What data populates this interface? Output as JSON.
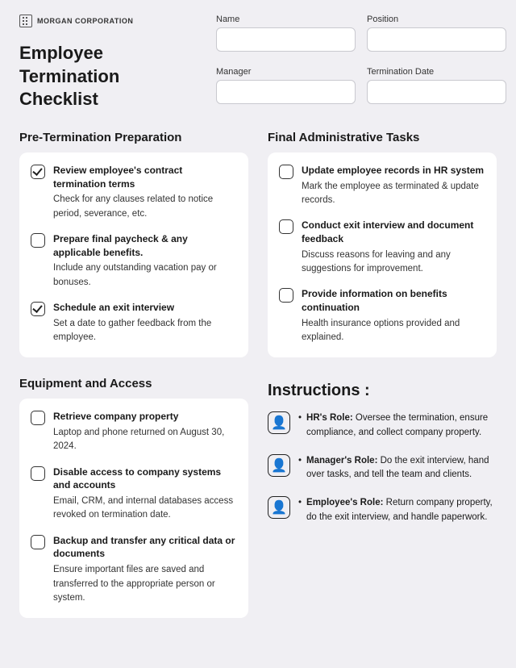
{
  "brand": "MORGAN CORPORATION",
  "title_line1": "Employee",
  "title_line2": "Termination Checklist",
  "fields": {
    "name": {
      "label": "Name",
      "value": ""
    },
    "position": {
      "label": "Position",
      "value": ""
    },
    "manager": {
      "label": "Manager",
      "value": ""
    },
    "termination_date": {
      "label": "Termination Date",
      "value": ""
    }
  },
  "sections": {
    "pre": {
      "heading": "Pre-Termination Preparation",
      "items": [
        {
          "checked": true,
          "title": "Review employee's contract termination terms",
          "desc": "Check for any clauses related to notice period, severance, etc."
        },
        {
          "checked": false,
          "title": "Prepare final paycheck & any applicable benefits.",
          "desc": "Include any outstanding vacation pay or bonuses."
        },
        {
          "checked": true,
          "title": "Schedule an exit interview",
          "desc": "Set a date to gather feedback from the employee."
        }
      ]
    },
    "admin": {
      "heading": "Final Administrative Tasks",
      "items": [
        {
          "checked": false,
          "title": "Update employee records in HR system",
          "desc": "Mark the employee as terminated & update records."
        },
        {
          "checked": false,
          "title": "Conduct exit interview and document feedback",
          "desc": "Discuss reasons for leaving and any suggestions for improvement."
        },
        {
          "checked": false,
          "title": "Provide information on benefits continuation",
          "desc": "Health insurance options provided and explained."
        }
      ]
    },
    "equip": {
      "heading": "Equipment and Access",
      "items": [
        {
          "checked": false,
          "title": "Retrieve company property",
          "desc": "Laptop and phone returned on August 30, 2024."
        },
        {
          "checked": false,
          "title": "Disable access to company systems and accounts",
          "desc": "Email, CRM, and internal databases access revoked on termination date."
        },
        {
          "checked": false,
          "title": "Backup and transfer any critical data or documents",
          "desc": "Ensure important files are saved and transferred to the appropriate person or system."
        }
      ]
    }
  },
  "instructions": {
    "heading": "Instructions :",
    "rows": [
      {
        "role": "HR's Role:",
        "text": "Oversee the termination, ensure compliance, and collect company property."
      },
      {
        "role": "Manager's Role:",
        "text": "Do the exit interview, hand over tasks, and tell the team and clients."
      },
      {
        "role": "Employee's Role:",
        "text": "Return company property, do the exit interview, and handle paperwork."
      }
    ]
  }
}
